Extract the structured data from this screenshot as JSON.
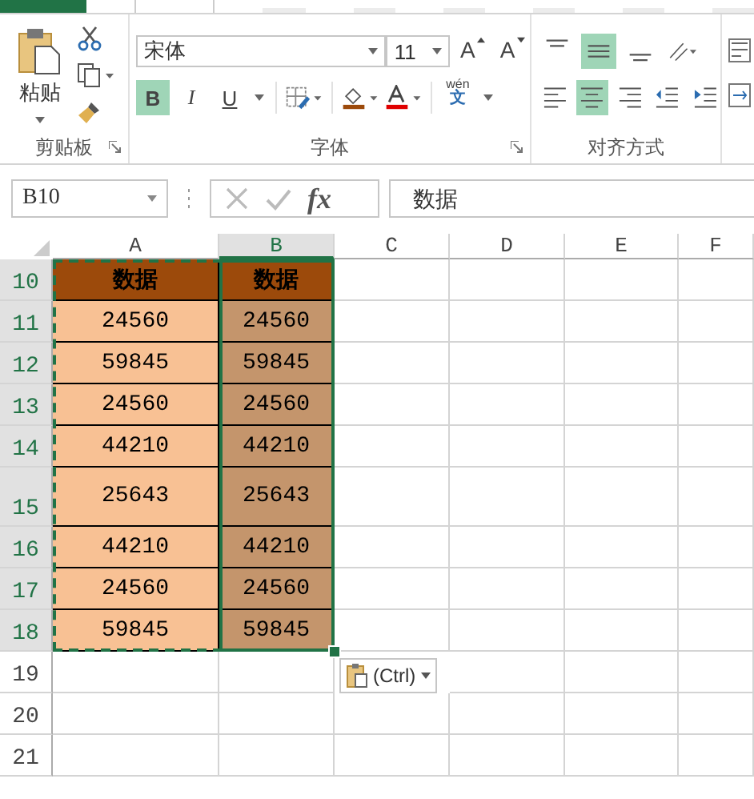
{
  "ribbon_tabs": [
    {
      "kind": "file",
      "selected": false
    },
    {
      "kind": "tab",
      "selected": true
    },
    {
      "kind": "tab",
      "selected": false
    },
    {
      "kind": "tab",
      "selected": false
    },
    {
      "kind": "tab",
      "selected": false
    },
    {
      "kind": "tab",
      "selected": false
    },
    {
      "kind": "tab",
      "selected": false
    },
    {
      "kind": "tab",
      "selected": false
    }
  ],
  "clipboard_group": {
    "paste_label": "粘贴",
    "label": "剪贴板"
  },
  "font_group": {
    "font_name": "宋体",
    "font_size": "11",
    "grow_label": "A",
    "shrink_label": "A",
    "bold": {
      "label": "B",
      "selected": true
    },
    "italic": {
      "label": "I",
      "selected": false
    },
    "underline": {
      "label": "U",
      "selected": false
    },
    "phonetic_top": "wén",
    "phonetic_bottom": "文",
    "label": "字体"
  },
  "alignment_group": {
    "vertical": [
      {
        "kind": "top",
        "selected": false
      },
      {
        "kind": "middle",
        "selected": true
      },
      {
        "kind": "bottom",
        "selected": false
      }
    ],
    "horizontal": [
      {
        "kind": "left",
        "selected": false
      },
      {
        "kind": "center",
        "selected": true
      },
      {
        "kind": "right",
        "selected": false
      }
    ],
    "label": "对齐方式"
  },
  "name_box": {
    "value": "B10"
  },
  "formula_bar": {
    "fx": "fx",
    "value": "数据"
  },
  "columns": [
    {
      "label": "A",
      "selected": false
    },
    {
      "label": "B",
      "selected": true
    },
    {
      "label": "C",
      "selected": false
    },
    {
      "label": "D",
      "selected": false
    },
    {
      "label": "E",
      "selected": false
    },
    {
      "label": "F",
      "selected": false
    }
  ],
  "rows": [
    {
      "header": "10",
      "selected": true,
      "cells": [
        {
          "text": "数据",
          "kind": "header"
        },
        {
          "text": "数据",
          "kind": "header"
        }
      ]
    },
    {
      "header": "11",
      "selected": true,
      "cells": [
        {
          "text": "24560",
          "kind": "data"
        },
        {
          "text": "24560",
          "kind": "data"
        }
      ]
    },
    {
      "header": "12",
      "selected": true,
      "cells": [
        {
          "text": "59845",
          "kind": "data"
        },
        {
          "text": "59845",
          "kind": "data"
        }
      ]
    },
    {
      "header": "13",
      "selected": true,
      "cells": [
        {
          "text": "24560",
          "kind": "data"
        },
        {
          "text": "24560",
          "kind": "data"
        }
      ]
    },
    {
      "header": "14",
      "selected": true,
      "cells": [
        {
          "text": "44210",
          "kind": "data"
        },
        {
          "text": "44210",
          "kind": "data"
        }
      ]
    },
    {
      "header": "15",
      "selected": true,
      "cells": [
        {
          "text": "25643",
          "kind": "data"
        },
        {
          "text": "25643",
          "kind": "data"
        }
      ]
    },
    {
      "header": "16",
      "selected": true,
      "cells": [
        {
          "text": "44210",
          "kind": "data"
        },
        {
          "text": "44210",
          "kind": "data"
        }
      ]
    },
    {
      "header": "17",
      "selected": true,
      "cells": [
        {
          "text": "24560",
          "kind": "data"
        },
        {
          "text": "24560",
          "kind": "data"
        }
      ]
    },
    {
      "header": "18",
      "selected": true,
      "cells": [
        {
          "text": "59845",
          "kind": "data"
        },
        {
          "text": "59845",
          "kind": "data"
        }
      ]
    },
    {
      "header": "19",
      "selected": false,
      "cells": []
    },
    {
      "header": "20",
      "selected": false,
      "cells": []
    },
    {
      "header": "21",
      "selected": false,
      "cells": []
    }
  ],
  "paste_options": {
    "label": "(Ctrl)"
  }
}
